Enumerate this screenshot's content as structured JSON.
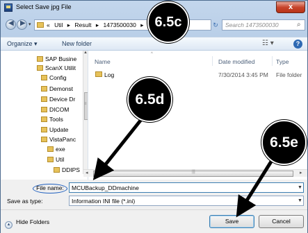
{
  "window": {
    "title": "Select Save jpg File",
    "close_label": "x"
  },
  "navigation": {
    "breadcrumbs": [
      "«",
      "Util",
      "▸",
      "Result",
      "▸",
      "1473500030",
      "▸"
    ],
    "search_placeholder": "Search 1473500030",
    "refresh_glyph": "↻",
    "search_glyph": "⌕"
  },
  "toolbar": {
    "organize_label": "Organize ▾",
    "new_folder_label": "New folder",
    "view_glyph": "☷ ▾",
    "help_glyph": "?"
  },
  "nav_tree": [
    {
      "label": "SAP Busine",
      "indent": 0
    },
    {
      "label": "ScanX Utilit",
      "indent": 0
    },
    {
      "label": "Config",
      "indent": 1
    },
    {
      "label": "Demonst",
      "indent": 1
    },
    {
      "label": "Device Dr",
      "indent": 1
    },
    {
      "label": "DICOM",
      "indent": 1
    },
    {
      "label": "Tools",
      "indent": 1
    },
    {
      "label": "Update",
      "indent": 1
    },
    {
      "label": "VistaPanc",
      "indent": 1
    },
    {
      "label": "exe",
      "indent": 2
    },
    {
      "label": "Util",
      "indent": 2
    },
    {
      "label": "DDIPS",
      "indent": 3
    }
  ],
  "file_list": {
    "columns": {
      "name": "Name",
      "date_modified": "Date modified",
      "type": "Type"
    },
    "rows": [
      {
        "name": "Log",
        "date_modified": "7/30/2014 3:45 PM",
        "type": "File folder"
      }
    ]
  },
  "form": {
    "file_name_label": "File name:",
    "file_name_value": "MCUBackup_DDmachine",
    "save_as_type_label": "Save as type:",
    "save_as_type_value": "Information INI file (*.ini)"
  },
  "footer": {
    "hide_folders_label": "Hide Folders",
    "save_label": "Save",
    "cancel_label": "Cancel"
  },
  "annotations": {
    "callout_1": "6.5c",
    "callout_2": "6.5d",
    "callout_3": "6.5e"
  }
}
